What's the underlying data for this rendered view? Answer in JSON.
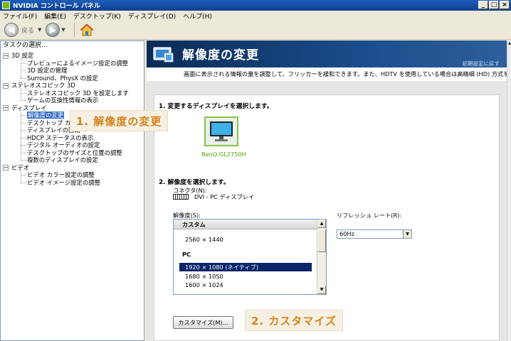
{
  "window": {
    "title": "NVIDIA コントロール パネル",
    "controls": [
      "_",
      "□",
      "×"
    ]
  },
  "menu": [
    "ファイル(F)",
    "編集(E)",
    "デスクトップ(K)",
    "ディスプレイ(D)",
    "ヘルプ(H)"
  ],
  "toolbar": {
    "back_label": "戻る"
  },
  "left_panel": {
    "header": "タスクの選択...",
    "tree": [
      {
        "label": "3D 設定",
        "level": 0,
        "expand": "−"
      },
      {
        "label": "プレビューによるイメージ設定の調整",
        "level": 1
      },
      {
        "label": "3D 設定の管理",
        "level": 1
      },
      {
        "label": "Surround、PhysX の設定",
        "level": 1
      },
      {
        "label": "ステレオスコピック 3D",
        "level": 0,
        "expand": "−"
      },
      {
        "label": "ステレオスコピック 3D を設定します",
        "level": 1
      },
      {
        "label": "ゲームの互換性情報の表示",
        "level": 1
      },
      {
        "label": "ディスプレイ",
        "level": 0,
        "expand": "−"
      },
      {
        "label": "解像度の変更",
        "level": 1,
        "selected": true
      },
      {
        "label": "デスクトップ カラー設定の調整",
        "level": 1
      },
      {
        "label": "ディスプレイの回転",
        "level": 1
      },
      {
        "label": "HDCP ステータスの表示",
        "level": 1
      },
      {
        "label": "デジタル オーディオの設定",
        "level": 1
      },
      {
        "label": "デスクトップのサイズと位置の調整",
        "level": 1
      },
      {
        "label": "複数のディスプレイの設定",
        "level": 1
      },
      {
        "label": "ビデオ",
        "level": 0,
        "expand": "−"
      },
      {
        "label": "ビデオ カラー設定の調整",
        "level": 1
      },
      {
        "label": "ビデオ イメージ設定の調整",
        "level": 1
      }
    ]
  },
  "page": {
    "title": "解像度の変更",
    "restore_defaults": "初期設定に戻す",
    "description": "画面に表示される情報の量を調整して、フリッカーを緩和できます。また、HDTV を使用している場合は高精細 (HD) 方式を選",
    "step1": "1. 変更するディスプレイを選択します。",
    "monitor_name": "BenQ GL2750H",
    "step2": "2. 解像度を選択します。",
    "connector_label": "コネクタ(N):",
    "connector_value": "DVI - PC ディスプレイ",
    "resolution_label": "解像度(S):",
    "refresh_label": "リフレッシュ レート(R):",
    "refresh_value": "60Hz",
    "resolution_list": [
      {
        "text": "カスタム",
        "group": true
      },
      {
        "text": "2560 × 1440"
      },
      {
        "text": "PC",
        "group": true
      },
      {
        "text": "1920 × 1080 (ネイティブ)",
        "selected": true
      },
      {
        "text": "1680 × 1050"
      },
      {
        "text": "1600 × 1024"
      }
    ],
    "customize_button": "カスタマイズ(M)..."
  },
  "annotations": {
    "callout1": "1. 解像度の変更",
    "callout2": "2. カスタマイズ"
  },
  "colors": {
    "accent_green": "#76b900",
    "selection": "#316ac5",
    "callout_text": "#d4831e"
  }
}
